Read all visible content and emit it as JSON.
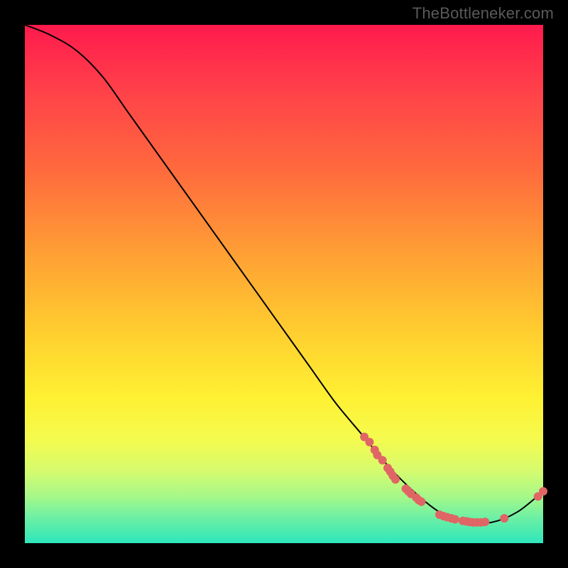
{
  "watermark": "TheBottleneker.com",
  "chart_data": {
    "type": "line",
    "title": "",
    "xlabel": "",
    "ylabel": "",
    "xlim": [
      0,
      100
    ],
    "ylim": [
      0,
      100
    ],
    "grid": false,
    "legend": false,
    "series": [
      {
        "name": "bottleneck-curve",
        "color": "#000000",
        "x": [
          0,
          5,
          10,
          15,
          20,
          25,
          30,
          35,
          40,
          45,
          50,
          55,
          60,
          65,
          70,
          75,
          80,
          85,
          90,
          95,
          100
        ],
        "y": [
          100,
          98,
          95,
          90,
          83,
          76,
          69,
          62,
          55,
          48,
          41,
          34,
          27,
          21,
          15,
          10,
          6,
          4,
          4,
          6,
          10
        ]
      }
    ],
    "markers": [
      {
        "name": "highlight-points",
        "color": "#e06666",
        "radius": 6,
        "points": [
          {
            "x": 65.5,
            "y": 20.5
          },
          {
            "x": 66.5,
            "y": 19.5
          },
          {
            "x": 67.5,
            "y": 18.0
          },
          {
            "x": 68.0,
            "y": 17.0
          },
          {
            "x": 69.0,
            "y": 16.0
          },
          {
            "x": 70.0,
            "y": 14.5
          },
          {
            "x": 70.5,
            "y": 13.8
          },
          {
            "x": 71.0,
            "y": 13.0
          },
          {
            "x": 71.5,
            "y": 12.3
          },
          {
            "x": 73.5,
            "y": 10.5
          },
          {
            "x": 74.0,
            "y": 10.0
          },
          {
            "x": 74.5,
            "y": 9.5
          },
          {
            "x": 75.5,
            "y": 8.8
          },
          {
            "x": 76.0,
            "y": 8.3
          },
          {
            "x": 76.5,
            "y": 8.0
          },
          {
            "x": 80.0,
            "y": 5.5
          },
          {
            "x": 80.8,
            "y": 5.2
          },
          {
            "x": 81.5,
            "y": 5.0
          },
          {
            "x": 82.3,
            "y": 4.8
          },
          {
            "x": 83.0,
            "y": 4.6
          },
          {
            "x": 84.5,
            "y": 4.3
          },
          {
            "x": 85.2,
            "y": 4.2
          },
          {
            "x": 85.8,
            "y": 4.1
          },
          {
            "x": 86.5,
            "y": 4.0
          },
          {
            "x": 87.2,
            "y": 4.0
          },
          {
            "x": 88.0,
            "y": 4.0
          },
          {
            "x": 88.8,
            "y": 4.1
          },
          {
            "x": 92.5,
            "y": 4.8
          },
          {
            "x": 99.0,
            "y": 9.0
          },
          {
            "x": 100.0,
            "y": 10.0
          }
        ]
      }
    ]
  }
}
